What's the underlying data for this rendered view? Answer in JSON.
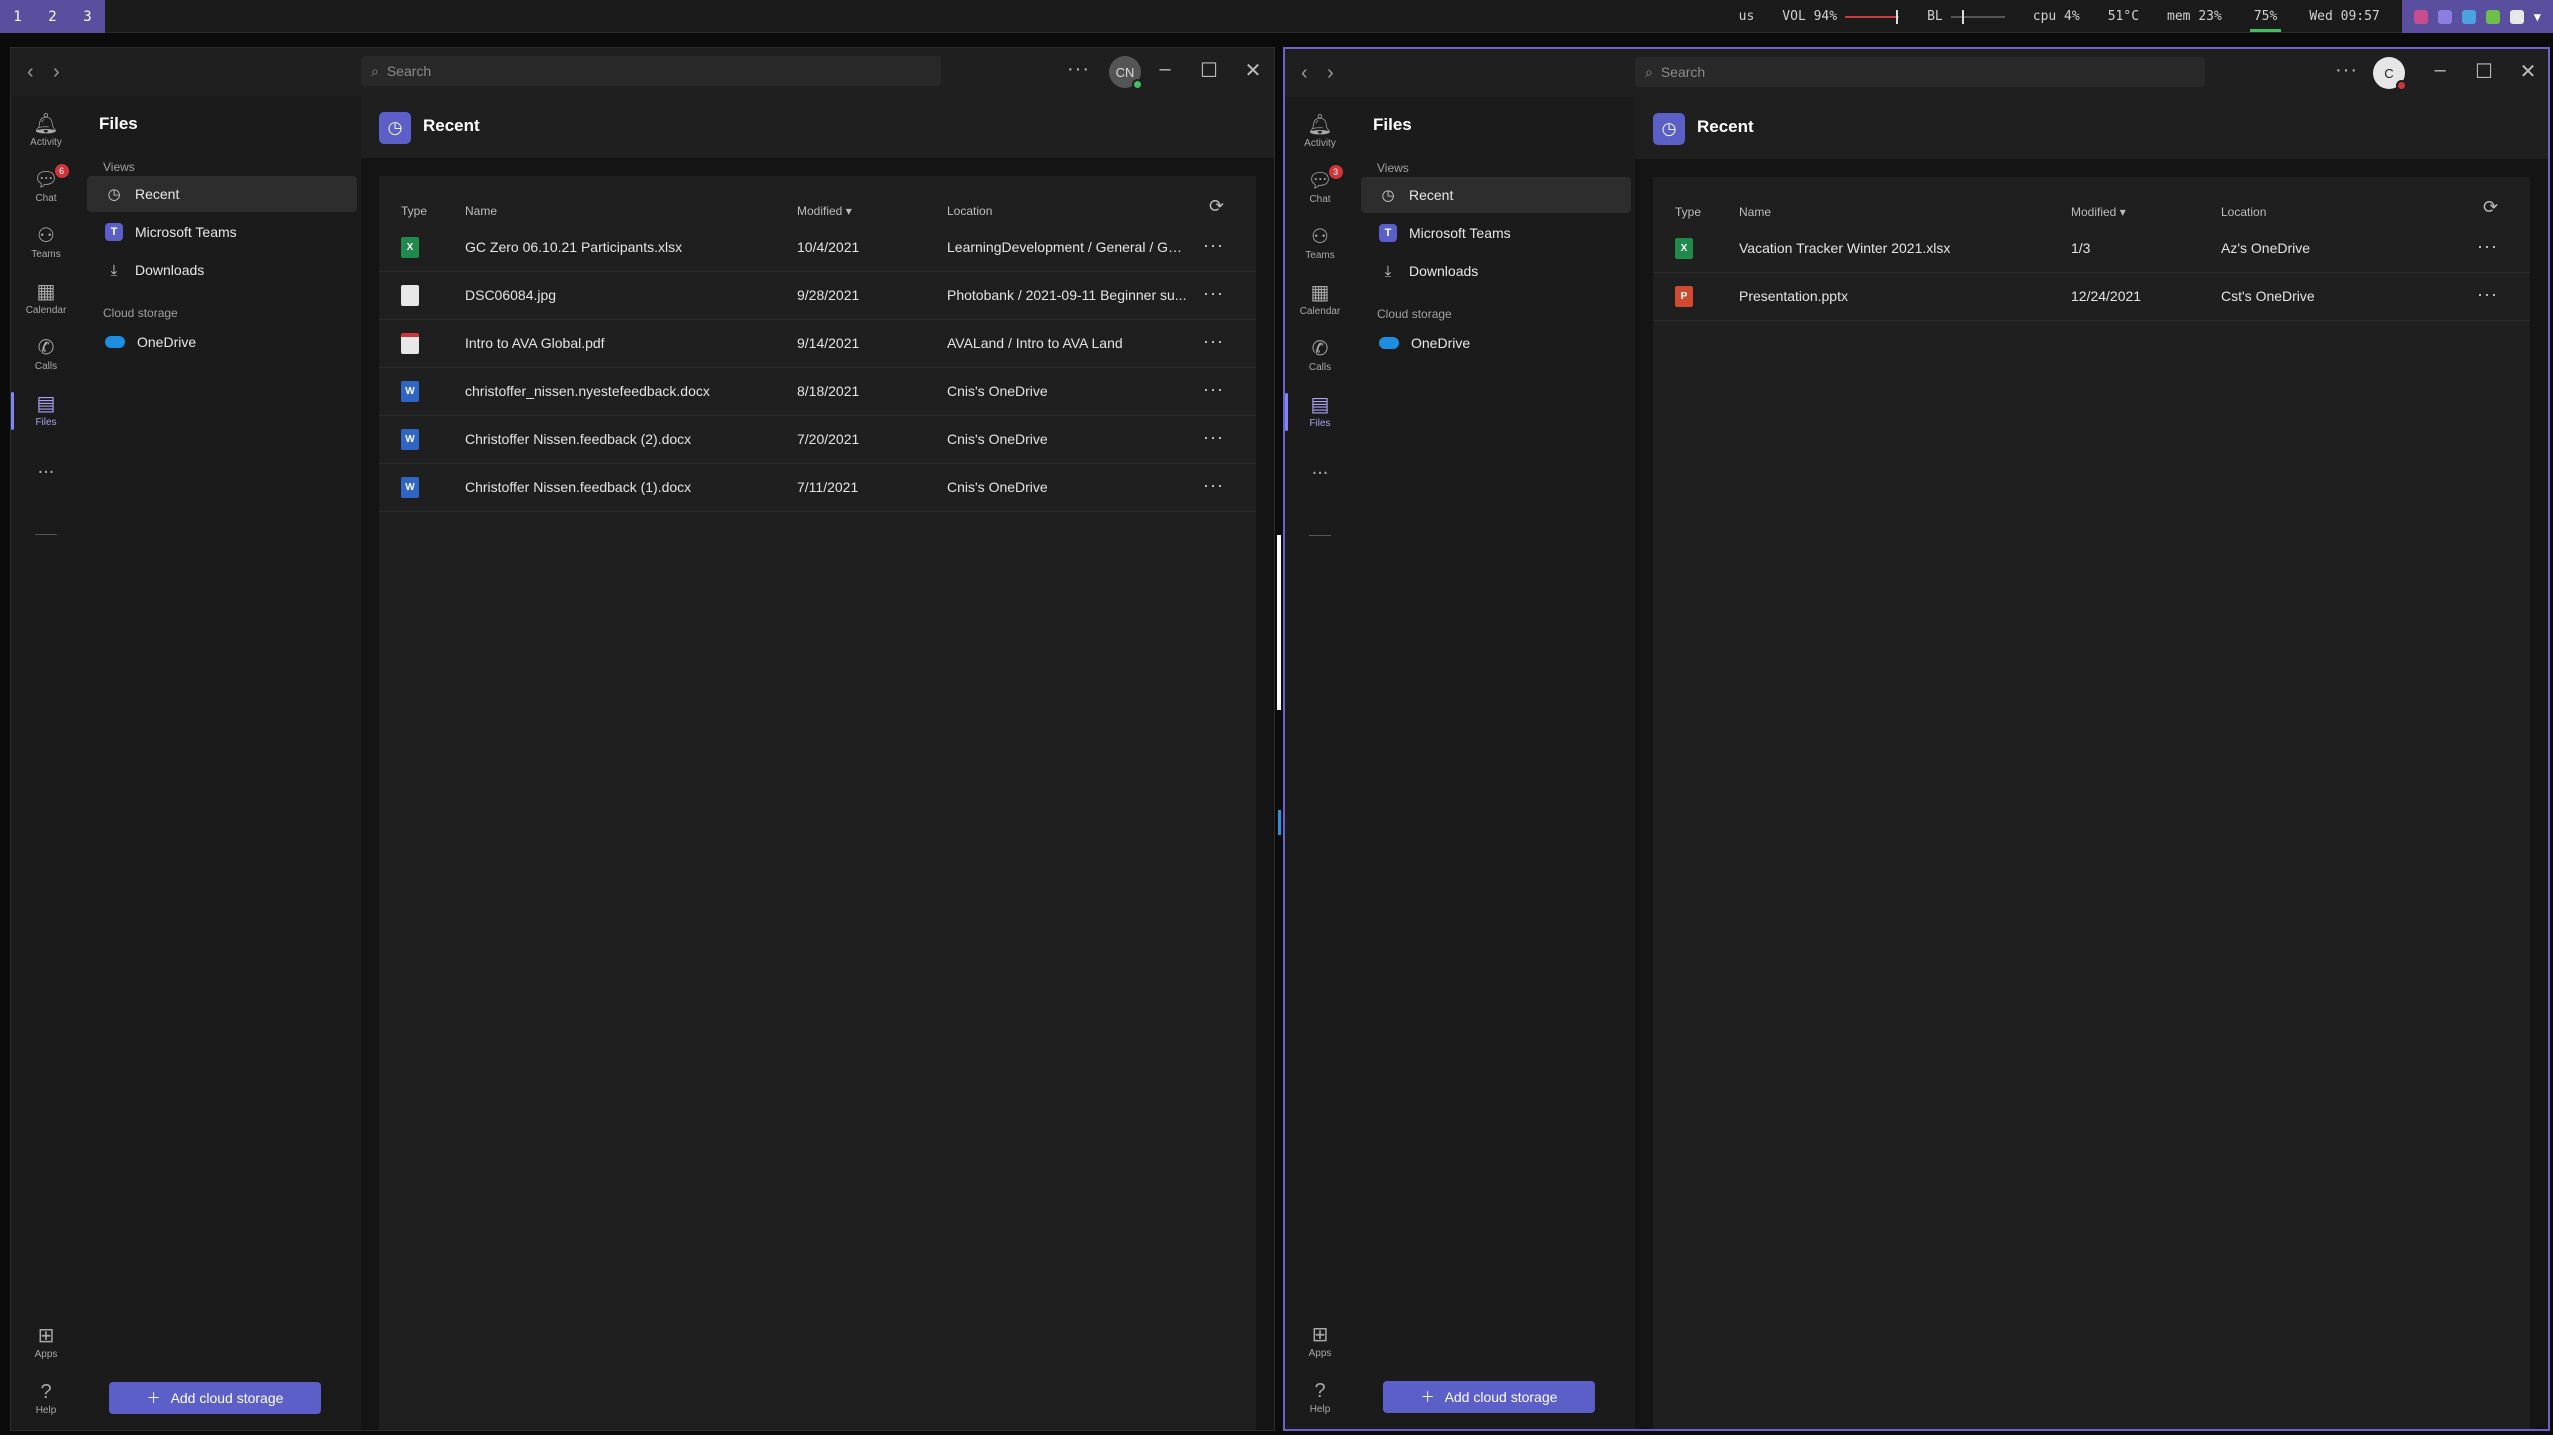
{
  "topbar": {
    "workspaces": [
      "1",
      "2",
      "3"
    ],
    "keyboard": "us",
    "volume": "VOL 94%",
    "volume_level": 0.94,
    "brightness": "BL",
    "brightness_level": 0.2,
    "cpu": "cpu  4%",
    "temp": "51°C",
    "mem": "mem 23%",
    "battery": "75%",
    "clock": "Wed 09:57"
  },
  "colors": {
    "accent": "#5b5fc7",
    "focus_border": "#6b63c8",
    "badge": "#d13438"
  },
  "windows": [
    {
      "search_placeholder": "Search",
      "avatar_initials": "CN",
      "status_color": "#3fbf5f",
      "rail": {
        "activity": "Activity",
        "chat": "Chat",
        "chat_badge": "6",
        "teams": "Teams",
        "calendar": "Calendar",
        "calls": "Calls",
        "files": "Files",
        "more": "...",
        "apps": "Apps",
        "help": "Help"
      },
      "files_nav": {
        "title": "Files",
        "views_label": "Views",
        "recent": "Recent",
        "microsoft_teams": "Microsoft Teams",
        "downloads": "Downloads",
        "cloud_label": "Cloud storage",
        "onedrive": "OneDrive",
        "add_cloud": "Add cloud storage"
      },
      "main": {
        "title": "Recent",
        "columns": {
          "type": "Type",
          "name": "Name",
          "modified": "Modified",
          "location": "Location"
        },
        "rows": [
          {
            "type": "xlsx",
            "name": "GC Zero 06.10.21 Participants.xlsx",
            "modified": "10/4/2021",
            "location": "LearningDevelopment / General / GC..."
          },
          {
            "type": "jpg",
            "name": "DSC06084.jpg",
            "modified": "9/28/2021",
            "location": "Photobank / 2021-09-11 Beginner su..."
          },
          {
            "type": "pdf",
            "name": "Intro to AVA Global.pdf",
            "modified": "9/14/2021",
            "location": "AVALand / Intro to AVA Land"
          },
          {
            "type": "docx",
            "name": "christoffer_nissen.nyestefeedback.docx",
            "modified": "8/18/2021",
            "location": "Cnis's OneDrive"
          },
          {
            "type": "docx",
            "name": "Christoffer Nissen.feedback (2).docx",
            "modified": "7/20/2021",
            "location": "Cnis's OneDrive"
          },
          {
            "type": "docx",
            "name": "Christoffer Nissen.feedback (1).docx",
            "modified": "7/11/2021",
            "location": "Cnis's OneDrive"
          }
        ]
      }
    },
    {
      "search_placeholder": "Search",
      "avatar_initials": "C",
      "status_color": "#d13438",
      "rail": {
        "activity": "Activity",
        "chat": "Chat",
        "chat_badge": "3",
        "teams": "Teams",
        "calendar": "Calendar",
        "calls": "Calls",
        "files": "Files",
        "more": "...",
        "apps": "Apps",
        "help": "Help"
      },
      "files_nav": {
        "title": "Files",
        "views_label": "Views",
        "recent": "Recent",
        "microsoft_teams": "Microsoft Teams",
        "downloads": "Downloads",
        "cloud_label": "Cloud storage",
        "onedrive": "OneDrive",
        "add_cloud": "Add cloud storage"
      },
      "main": {
        "title": "Recent",
        "columns": {
          "type": "Type",
          "name": "Name",
          "modified": "Modified",
          "location": "Location"
        },
        "rows": [
          {
            "type": "xlsx",
            "name": "Vacation Tracker Winter 2021.xlsx",
            "modified": "1/3",
            "location": "Az's OneDrive"
          },
          {
            "type": "pptx",
            "name": "Presentation.pptx",
            "modified": "12/24/2021",
            "location": "Cst's OneDrive"
          }
        ]
      }
    }
  ]
}
